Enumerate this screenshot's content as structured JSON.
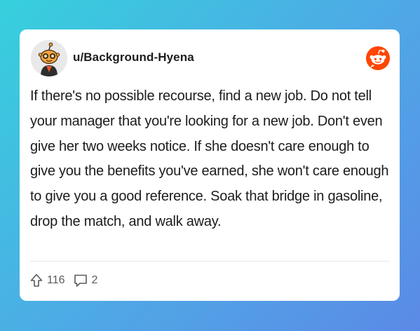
{
  "post": {
    "username": "u/Background-Hyena",
    "avatar_icon": "snoo-avatar-icon",
    "brand_icon": "reddit-logo-icon",
    "brand_color": "#ff4500",
    "body": "If there's no possible recourse, find a new job. Do not tell your manager that you're looking for a new job. Don't even give her two weeks notice. If she doesn't care enough to give you the benefits you've earned, she won't care enough to give you a good reference. Soak that bridge in gasoline, drop the match, and walk away.",
    "upvotes": "116",
    "comments": "2"
  }
}
